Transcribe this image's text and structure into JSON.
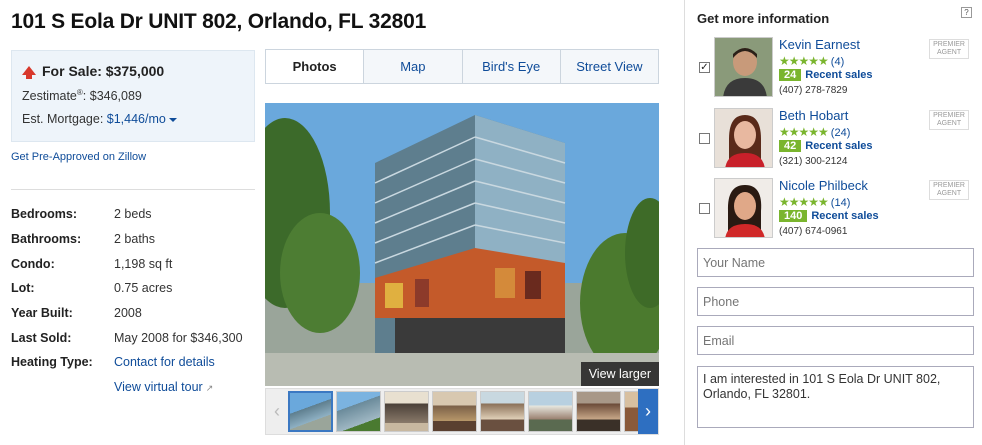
{
  "listing": {
    "title": "101 S Eola Dr UNIT 802, Orlando, FL 32801",
    "for_sale": "For Sale: $375,000",
    "zestimate_label": "Zestimate",
    "zestimate_mark": "®",
    "zestimate_value": ": $346,089",
    "mortgage_label": "Est. Mortgage: ",
    "mortgage_value": "$1,446/mo",
    "preapproved_link": "Get Pre-Approved on Zillow"
  },
  "facts": [
    {
      "label": "Bedrooms:",
      "value": "2 beds"
    },
    {
      "label": "Bathrooms:",
      "value": "2 baths"
    },
    {
      "label": "Condo:",
      "value": "1,198 sq ft"
    },
    {
      "label": "Lot:",
      "value": "0.75 acres"
    },
    {
      "label": "Year Built:",
      "value": "2008"
    },
    {
      "label": "Last Sold:",
      "value": "May 2008 for $346,300"
    },
    {
      "label": "Heating Type:",
      "value": "Contact for details"
    }
  ],
  "virtual_tour": "View virtual tour",
  "media": {
    "tabs": [
      "Photos",
      "Map",
      "Bird's Eye",
      "Street View"
    ],
    "view_larger": "View larger"
  },
  "sidebar": {
    "title": "Get more information",
    "help": "?",
    "premier": [
      "PREMIER",
      "AGENT"
    ],
    "agents": [
      {
        "name": "Kevin Earnest",
        "stars": "★★★★★",
        "reviews": "(4)",
        "sales_count": "24",
        "sales_label": "Recent sales",
        "phone": "(407) 278-7829",
        "checked": true
      },
      {
        "name": "Beth Hobart",
        "stars": "★★★★★",
        "reviews": "(24)",
        "sales_count": "42",
        "sales_label": "Recent sales",
        "phone": "(321) 300-2124",
        "checked": false
      },
      {
        "name": "Nicole Philbeck",
        "stars": "★★★★★",
        "reviews": "(14)",
        "sales_count": "140",
        "sales_label": "Recent sales",
        "phone": "(407) 674-0961",
        "checked": false
      }
    ],
    "form": {
      "name_placeholder": "Your Name",
      "phone_placeholder": "Phone",
      "email_placeholder": "Email",
      "message": "I am interested in 101 S Eola Dr UNIT 802, Orlando, FL 32801."
    }
  },
  "colors": {
    "accent": "#0f4c99",
    "stars": "#7ab52e",
    "sale_arrow": "#d8382c"
  }
}
